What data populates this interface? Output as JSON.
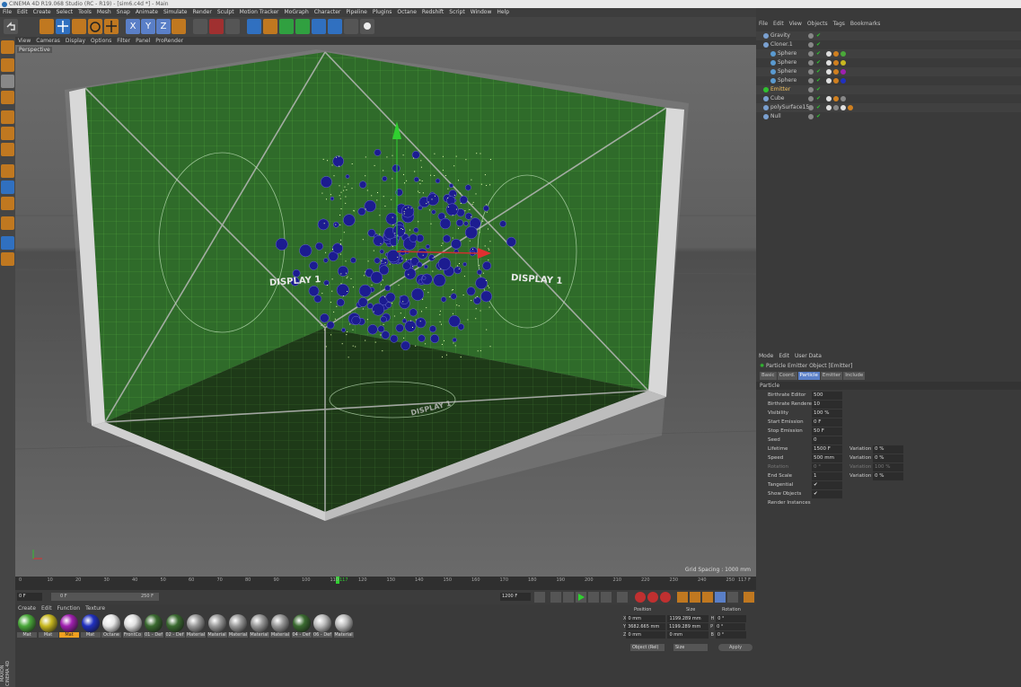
{
  "window": {
    "title": "CINEMA 4D R19.068 Studio (RC - R19) - [sim6.c4d *] - Main"
  },
  "menubar": {
    "items": [
      "File",
      "Edit",
      "Create",
      "Select",
      "Tools",
      "Mesh",
      "Snap",
      "Animate",
      "Simulate",
      "Render",
      "Sculpt",
      "Motion Tracker",
      "MoGraph",
      "Character",
      "Pipeline",
      "Plugins",
      "Octane",
      "Redshift",
      "Script",
      "Window",
      "Help"
    ]
  },
  "viewport": {
    "menu": [
      "View",
      "Cameras",
      "Display",
      "Options",
      "Filter",
      "Panel",
      "ProRender"
    ],
    "camera_label": "Perspective",
    "wall_text_left": "DISPLAY 1",
    "wall_text_right": "DISPLAY 1",
    "floor_text": "DISPLAY 1",
    "grid_spacing": "Grid Spacing : 1000 mm",
    "accent_green": "#2f6b2a",
    "particle_color": "#1a1a8a"
  },
  "timeline": {
    "ticks": [
      "0",
      "10",
      "20",
      "30",
      "40",
      "50",
      "60",
      "70",
      "80",
      "90",
      "100",
      "110",
      "120",
      "130",
      "140",
      "150",
      "160",
      "170",
      "180",
      "190",
      "200",
      "210",
      "220",
      "230",
      "240",
      "250"
    ],
    "current_frame": "117",
    "end_label": "117 F",
    "start_field": "0 F",
    "min_field": "0 F",
    "max_field": "250 F",
    "end_field": "1200 F"
  },
  "materials": {
    "menu": [
      "Create",
      "Edit",
      "Function",
      "Texture"
    ],
    "items": [
      {
        "label": "Mat",
        "color": "#4aa83a"
      },
      {
        "label": "Mat",
        "color": "#c8b820"
      },
      {
        "label": "Mat",
        "color": "#a020b0",
        "selected": true
      },
      {
        "label": "Mat",
        "color": "#2030c0"
      },
      {
        "label": "Octane",
        "color": "#e8e8e8"
      },
      {
        "label": "FrontCo",
        "color": "#e0e0e0"
      },
      {
        "label": "01 - Def",
        "color": "#3a6a30"
      },
      {
        "label": "02 - Def",
        "color": "#3a6a30"
      },
      {
        "label": "Material",
        "color": "#9a9a9a"
      },
      {
        "label": "Material",
        "color": "#9a9a9a"
      },
      {
        "label": "Material",
        "color": "#9a9a9a"
      },
      {
        "label": "Material",
        "color": "#9a9a9a"
      },
      {
        "label": "Material",
        "color": "#9a9a9a"
      },
      {
        "label": "04 - Def",
        "color": "#3a6a30"
      },
      {
        "label": "06 - Def",
        "color": "#bdbdbd"
      },
      {
        "label": "Material",
        "color": "#bdbdbd"
      }
    ]
  },
  "coords": {
    "headers": [
      "Position",
      "Size",
      "Rotation"
    ],
    "rows": [
      {
        "axis": "X",
        "pos": "0 mm",
        "size": "1199.289 mm",
        "rot_axis": "H",
        "rot": "0 °"
      },
      {
        "axis": "Y",
        "pos": "3682.665 mm",
        "size": "1199.289 mm",
        "rot_axis": "P",
        "rot": "0 °"
      },
      {
        "axis": "Z",
        "pos": "0 mm",
        "size": "0 mm",
        "rot_axis": "B",
        "rot": "0 °"
      }
    ],
    "mode_select": "Object (Rel)",
    "size_select": "Size",
    "apply": "Apply"
  },
  "object_manager": {
    "menu": [
      "File",
      "Edit",
      "View",
      "Objects",
      "Tags",
      "Bookmarks"
    ],
    "objects": [
      {
        "name": "Gravity",
        "indent": 0,
        "color": "#c8c8c8",
        "tags": []
      },
      {
        "name": "Cloner.1",
        "indent": 0,
        "color": "#c8c8c8",
        "tags": []
      },
      {
        "name": "Sphere",
        "indent": 1,
        "color": "#c8c8c8",
        "tags": [
          "#e0e0e0",
          "#d08020",
          "#4aa83a"
        ]
      },
      {
        "name": "Sphere",
        "indent": 1,
        "color": "#c8c8c8",
        "tags": [
          "#e0e0e0",
          "#d08020",
          "#c8b820"
        ]
      },
      {
        "name": "Sphere",
        "indent": 1,
        "color": "#c8c8c8",
        "tags": [
          "#e0e0e0",
          "#d08020",
          "#a020b0"
        ]
      },
      {
        "name": "Sphere",
        "indent": 1,
        "color": "#c8c8c8",
        "tags": [
          "#e0e0e0",
          "#d08020",
          "#2030c0"
        ]
      },
      {
        "name": "Emitter",
        "indent": 0,
        "color": "#f0c060",
        "tags": []
      },
      {
        "name": "Cube",
        "indent": 0,
        "color": "#c8c8c8",
        "tags": [
          "#e0e0e0",
          "#d08020",
          "#888888"
        ]
      },
      {
        "name": "polySurface15",
        "indent": 0,
        "color": "#c8c8c8",
        "tags": [
          "#e0e0e0",
          "#888888",
          "#e0e0e0",
          "#d08020"
        ]
      },
      {
        "name": "Null",
        "indent": 0,
        "color": "#c8c8c8",
        "tags": []
      }
    ]
  },
  "attribute_manager": {
    "menu": [
      "Mode",
      "Edit",
      "User Data"
    ],
    "title": "Particle Emitter Object [Emitter]",
    "tabs": [
      "Basic",
      "Coord.",
      "Particle",
      "Emitter",
      "Include"
    ],
    "active_tab": "Particle",
    "section": "Particle",
    "params": [
      {
        "label": "Birthrate Editor",
        "value": "500"
      },
      {
        "label": "Birthrate Renderer",
        "value": "10"
      },
      {
        "label": "Visibility",
        "value": "100 %"
      },
      {
        "label": "Start Emission",
        "value": "0 F"
      },
      {
        "label": "Stop Emission",
        "value": "50 F"
      },
      {
        "label": "Seed",
        "value": "0"
      },
      {
        "label": "Lifetime",
        "value": "1500 F",
        "var_label": "Variation",
        "var": "0 %"
      },
      {
        "label": "Speed",
        "value": "500 mm",
        "var_label": "Variation",
        "var": "0 %"
      },
      {
        "label": "Rotation",
        "value": "0 °",
        "var_label": "Variation",
        "var": "100 %",
        "dim": true
      },
      {
        "label": "End Scale",
        "value": "1",
        "var_label": "Variation",
        "var": "0 %"
      },
      {
        "label": "Tangential",
        "value": "✔"
      },
      {
        "label": "Show Objects",
        "value": "✔"
      },
      {
        "label": "Render Instances",
        "value": ""
      }
    ]
  },
  "branding": {
    "text": "MAXON CINEMA 4D"
  }
}
